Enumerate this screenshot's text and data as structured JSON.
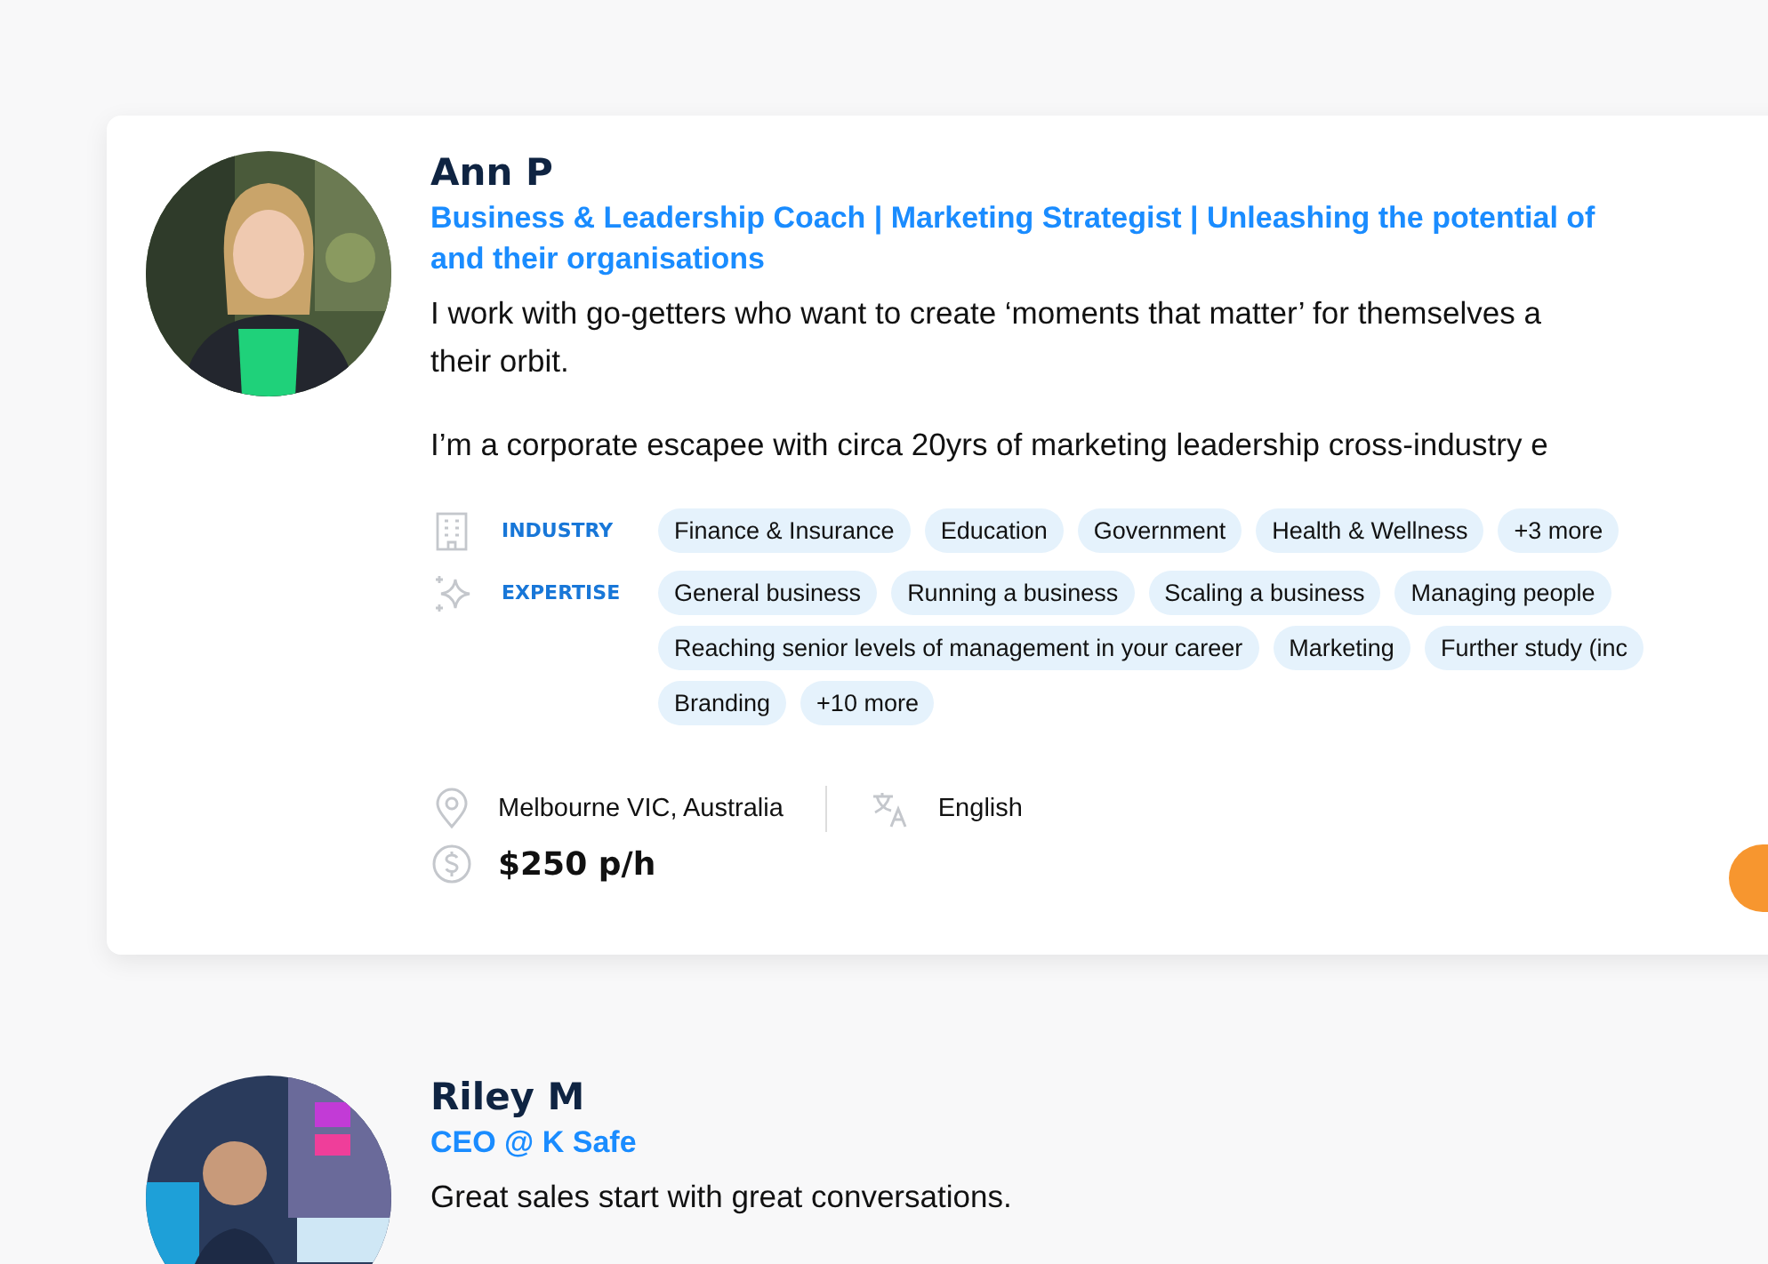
{
  "profiles": [
    {
      "name": "Ann P",
      "headline": "Business & Leadership Coach | Marketing Strategist | Unleashing the potential of\nand their organisations",
      "bio": [
        "I work with go-getters who want to create ‘moments that matter’ for themselves a\ntheir orbit.",
        "I’m a corporate escapee with circa 20yrs of marketing leadership cross-industry e"
      ],
      "avatar": {
        "kind": "picture"
      },
      "facets": [
        {
          "label": "INDUSTRY",
          "tags": [
            "Finance & Insurance",
            "Education",
            "Government",
            "Health & Wellness",
            "+3 more"
          ]
        },
        {
          "label": "EXPERTISE",
          "tags": [
            "General business",
            "Running a business",
            "Scaling a business",
            "Managing people",
            "Reaching senior levels of management in your career",
            "Marketing",
            "Further study (inc",
            "Branding",
            "+10 more"
          ]
        }
      ],
      "location": "Melbourne VIC, Australia",
      "language": "English",
      "rate": "$250 p/h",
      "kind": "card"
    },
    {
      "name": "Riley M",
      "headline": "CEO @ K Safe",
      "bio": [
        "Great sales start with great conversations."
      ],
      "avatar": {
        "kind": "picture"
      },
      "kind": "plain"
    }
  ]
}
